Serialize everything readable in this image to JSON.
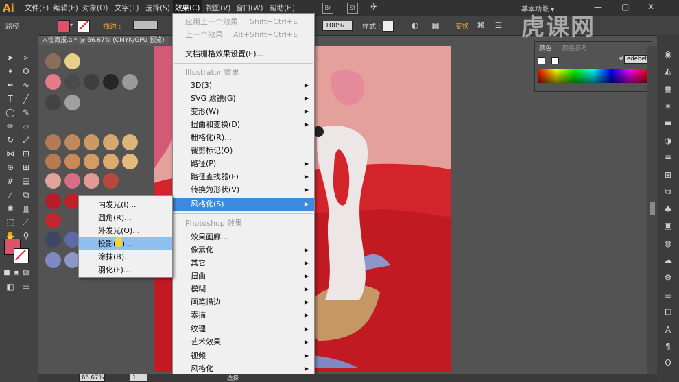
{
  "app": {
    "logo": "Ai"
  },
  "menubar": {
    "items": [
      "文件(F)",
      "编辑(E)",
      "对象(O)",
      "文字(T)",
      "选择(S)",
      "效果(C)",
      "视图(V)",
      "窗口(W)",
      "帮助(H)"
    ],
    "workspace": "基本功能 ▾",
    "search_placeholder": ""
  },
  "controlbar": {
    "path_label": "路径",
    "stroke_label": "描边 :",
    "zoom_value": "100%",
    "style_label": "样式 :",
    "transform_label": "变换"
  },
  "document": {
    "tab_title": "人性海报.ai* @ 66.67% (CMYK/GPU 预览)"
  },
  "effect_menu": {
    "apply_last": "应用上一个效果",
    "apply_last_shortcut": "Shift+Ctrl+E",
    "last_effect": "上一个效果",
    "last_effect_shortcut": "Alt+Shift+Ctrl+E",
    "raster_settings": "文档栅格效果设置(E)...",
    "illustrator_header": "Illustrator 效果",
    "illustrator_items": [
      "3D(3)",
      "SVG 滤镜(G)",
      "变形(W)",
      "扭曲和变换(D)",
      "栅格化(R)...",
      "裁剪标记(O)",
      "路径(P)",
      "路径查找器(F)",
      "转换为形状(V)",
      "风格化(S)"
    ],
    "photoshop_header": "Photoshop 效果",
    "photoshop_items": [
      "效果画廊...",
      "像素化",
      "其它",
      "扭曲",
      "模糊",
      "画笔描边",
      "素描",
      "纹理",
      "艺术效果",
      "视频",
      "风格化"
    ]
  },
  "stylize_submenu": {
    "items": [
      "内发光(I)...",
      "圆角(R)...",
      "外发光(O)...",
      "投影(D)...",
      "涂抹(B)...",
      "羽化(F)..."
    ],
    "selected_index": 3
  },
  "color_panel": {
    "tabs": [
      "颜色",
      "颜色参考"
    ],
    "hex_value": "edebeb",
    "hex_prefix": "#"
  },
  "statusbar": {
    "zoom": "66.67%",
    "page": "1",
    "tool": "选择"
  },
  "watermark": {
    "text": "虎课网"
  },
  "colors": {
    "selected_menu": "#3c8be0",
    "accent_red": "#d4242b"
  }
}
